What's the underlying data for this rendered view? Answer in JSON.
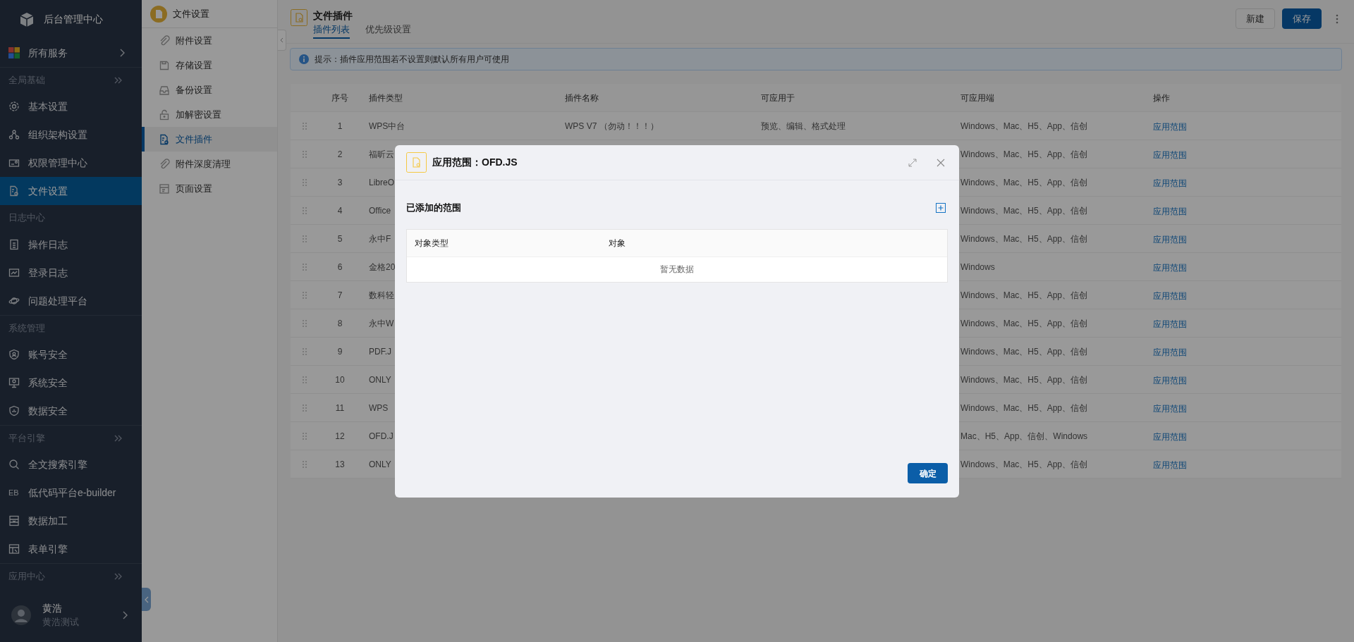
{
  "app": {
    "title": "后台管理中心"
  },
  "all_services": {
    "label": "所有服务"
  },
  "sidebar": {
    "sections": [
      {
        "title": "全局基础",
        "collapsible": true,
        "items": [
          {
            "label": "基本设置",
            "selected": false
          },
          {
            "label": "组织架构设置",
            "selected": false
          },
          {
            "label": "权限管理中心",
            "selected": false
          },
          {
            "label": "文件设置",
            "selected": true
          }
        ]
      },
      {
        "title": "日志中心",
        "collapsible": false,
        "items": [
          {
            "label": "操作日志",
            "selected": false
          },
          {
            "label": "登录日志",
            "selected": false
          },
          {
            "label": "问题处理平台",
            "selected": false
          }
        ]
      },
      {
        "title": "系统管理",
        "collapsible": false,
        "items": [
          {
            "label": "账号安全",
            "selected": false
          },
          {
            "label": "系统安全",
            "selected": false
          },
          {
            "label": "数据安全",
            "selected": false
          }
        ]
      },
      {
        "title": "平台引擎",
        "collapsible": true,
        "items": [
          {
            "label": "全文搜索引擎",
            "selected": false
          },
          {
            "label": "低代码平台e-builder",
            "selected": false,
            "icon_text": "EB"
          },
          {
            "label": "数据加工",
            "selected": false
          },
          {
            "label": "表单引擎",
            "selected": false
          }
        ]
      },
      {
        "title": "应用中心",
        "collapsible": true
      }
    ]
  },
  "user": {
    "name": "黄浩",
    "subtitle": "黄浩测试"
  },
  "subnav": {
    "title": "文件设置",
    "items": [
      {
        "label": "附件设置",
        "selected": false
      },
      {
        "label": "存储设置",
        "selected": false
      },
      {
        "label": "备份设置",
        "selected": false
      },
      {
        "label": "加解密设置",
        "selected": false
      },
      {
        "label": "文件插件",
        "selected": true
      },
      {
        "label": "附件深度清理",
        "selected": false
      },
      {
        "label": "页面设置",
        "selected": false
      }
    ]
  },
  "page": {
    "title": "文件插件",
    "tabs": [
      {
        "label": "插件列表",
        "selected": true
      },
      {
        "label": "优先级设置",
        "selected": false
      }
    ],
    "buttons": [
      {
        "label": "新建",
        "kind": "secondary"
      },
      {
        "label": "保存",
        "kind": "primary"
      }
    ]
  },
  "notice": {
    "text": "提示：插件应用范围若不设置则默认所有用户可使用"
  },
  "table": {
    "columns": [
      "序号",
      "插件类型",
      "插件名称",
      "可应用于",
      "可应用端",
      "操作"
    ],
    "rows": [
      {
        "index": "1",
        "type": "WPS中台",
        "name": "WPS V7 （勿动！！！）",
        "usage": "预览、编辑、格式处理",
        "clients": "Windows、Mac、H5、App、信创",
        "action": "应用范围"
      },
      {
        "index": "2",
        "type": "福昕云",
        "clients": "Windows、Mac、H5、App、信创",
        "action": "应用范围"
      },
      {
        "index": "3",
        "type": "LibreO",
        "clients": "Windows、Mac、H5、App、信创",
        "action": "应用范围"
      },
      {
        "index": "4",
        "type": "Office",
        "clients": "Windows、Mac、H5、App、信创",
        "action": "应用范围"
      },
      {
        "index": "5",
        "type": "永中F",
        "clients": "Windows、Mac、H5、App、信创",
        "action": "应用范围"
      },
      {
        "index": "6",
        "type": "金格20",
        "clients": "Windows",
        "action": "应用范围"
      },
      {
        "index": "7",
        "type": "数科轻",
        "clients": "Windows、Mac、H5、App、信创",
        "action": "应用范围"
      },
      {
        "index": "8",
        "type": "永中W",
        "clients": "Windows、Mac、H5、App、信创",
        "action": "应用范围"
      },
      {
        "index": "9",
        "type": "PDF.J",
        "clients": "Windows、Mac、H5、App、信创",
        "action": "应用范围"
      },
      {
        "index": "10",
        "type": "ONLY",
        "clients": "Windows、Mac、H5、App、信创",
        "action": "应用范围"
      },
      {
        "index": "11",
        "type": "WPS",
        "clients": "Windows、Mac、H5、App、信创",
        "action": "应用范围"
      },
      {
        "index": "12",
        "type": "OFD.J",
        "clients": "Mac、H5、App、信创、Windows",
        "action": "应用范围"
      },
      {
        "index": "13",
        "type": "ONLY",
        "clients": "Windows、Mac、H5、App、信创",
        "action": "应用范围"
      }
    ]
  },
  "dialog": {
    "title": "应用范围：OFD.JS",
    "section_title": "已添加的范围",
    "columns": [
      "对象类型",
      "对象"
    ],
    "empty_text": "暂无数据",
    "confirm": "确定"
  }
}
